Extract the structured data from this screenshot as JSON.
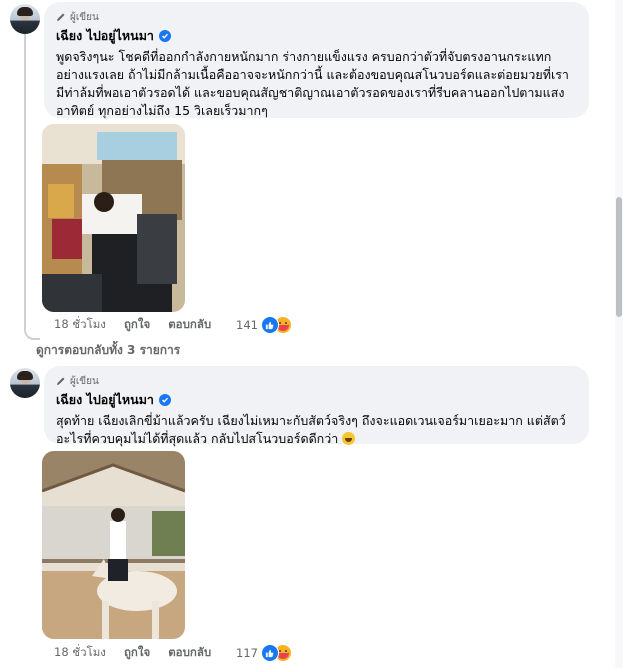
{
  "comments": [
    {
      "badge": "ผู้เขียน",
      "author": "เฉียง ไปอยู่ไหนมา",
      "text": "พูดจริงๆนะ โชคดีที่ออกกำลังกายหนักมาก ร่างกายแข็งแรง ครบอกว่าตัวที่จับตรงอานกระแทก อย่างแรงเลย ถ้าไม่มีกล้ามเนื้อคืออาจจะหนักกว่านี้ และต้องขอบคุณสโนวบอร์ดและต่อยมวยที่เรามีท่าล้มที่พอเอาตัวรอดได้ และขอบคุณสัญชาติญาณเอาตัวรอดของเราที่รีบคลานออกไปตามแสงอาทิตย์ ทุกอย่างไม่ถึง 15 วิเลยเร็วมากๆ",
      "time": "18 ชั่วโมง",
      "like_label": "ถูกใจ",
      "reply_label": "ตอบกลับ",
      "reaction_count": "141"
    },
    {
      "badge": "ผู้เขียน",
      "author": "เฉียง ไปอยู่ไหนมา",
      "text": "สุดท้าย เฉียงเลิกขี่ม้าแล้วครับ เฉียงไม่เหมาะกับสัตว์จริงๆ ถึงจะแอดเวนเจอร์มาเยอะมาก แต่สัตว์อะไรที่ควบคุมไม่ได้ที่สุดแล้ว กลับไปสโนวบอร์ดดีกว่า",
      "time": "18 ชั่วโมง",
      "like_label": "ถูกใจ",
      "reply_label": "ตอบกลับ",
      "reaction_count": "117"
    }
  ],
  "view_replies": "ดูการตอบกลับทั้ง 3 รายการ",
  "colors": {
    "bubble": "#f0f2f5",
    "accent": "#1877f2",
    "muted": "#65676b"
  }
}
